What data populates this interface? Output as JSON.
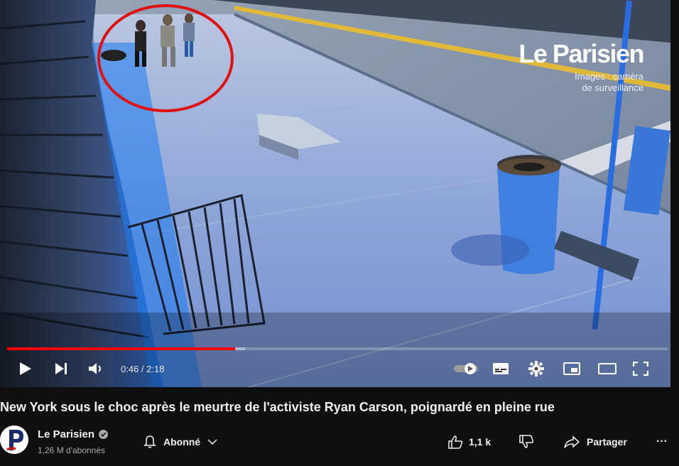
{
  "video": {
    "watermark_logo": "Le Parisien",
    "watermark_caption_1": "Images : caméra",
    "watermark_caption_2": "de surveillance",
    "played_fraction": 0.345,
    "buffered_fraction": 0.36,
    "time_current": "0:46",
    "time_total": "2:18",
    "time_display": "0:46 / 2:18"
  },
  "controls": {
    "play_icon": "play-icon",
    "next_icon": "next-icon",
    "volume_icon": "volume-icon",
    "autoplay_icon": "autoplay-toggle-icon",
    "subtitles_icon": "subtitles-icon",
    "settings_icon": "gear-icon",
    "miniplayer_icon": "miniplayer-icon",
    "theater_icon": "theater-icon",
    "fullscreen_icon": "fullscreen-icon"
  },
  "info": {
    "title": "New York sous le choc après le meurtre de l'activiste Ryan Carson, poignardé en pleine rue",
    "channel_name": "Le Parisien",
    "subscribers": "1,26 M d'abonnés",
    "subscribe_label": "Abonné",
    "likes": "1,1 k",
    "share_label": "Partager",
    "more_label": "···"
  },
  "colors": {
    "progress": "#ff0000",
    "background": "#0f0f0f",
    "annotation_circle": "#e01010"
  }
}
